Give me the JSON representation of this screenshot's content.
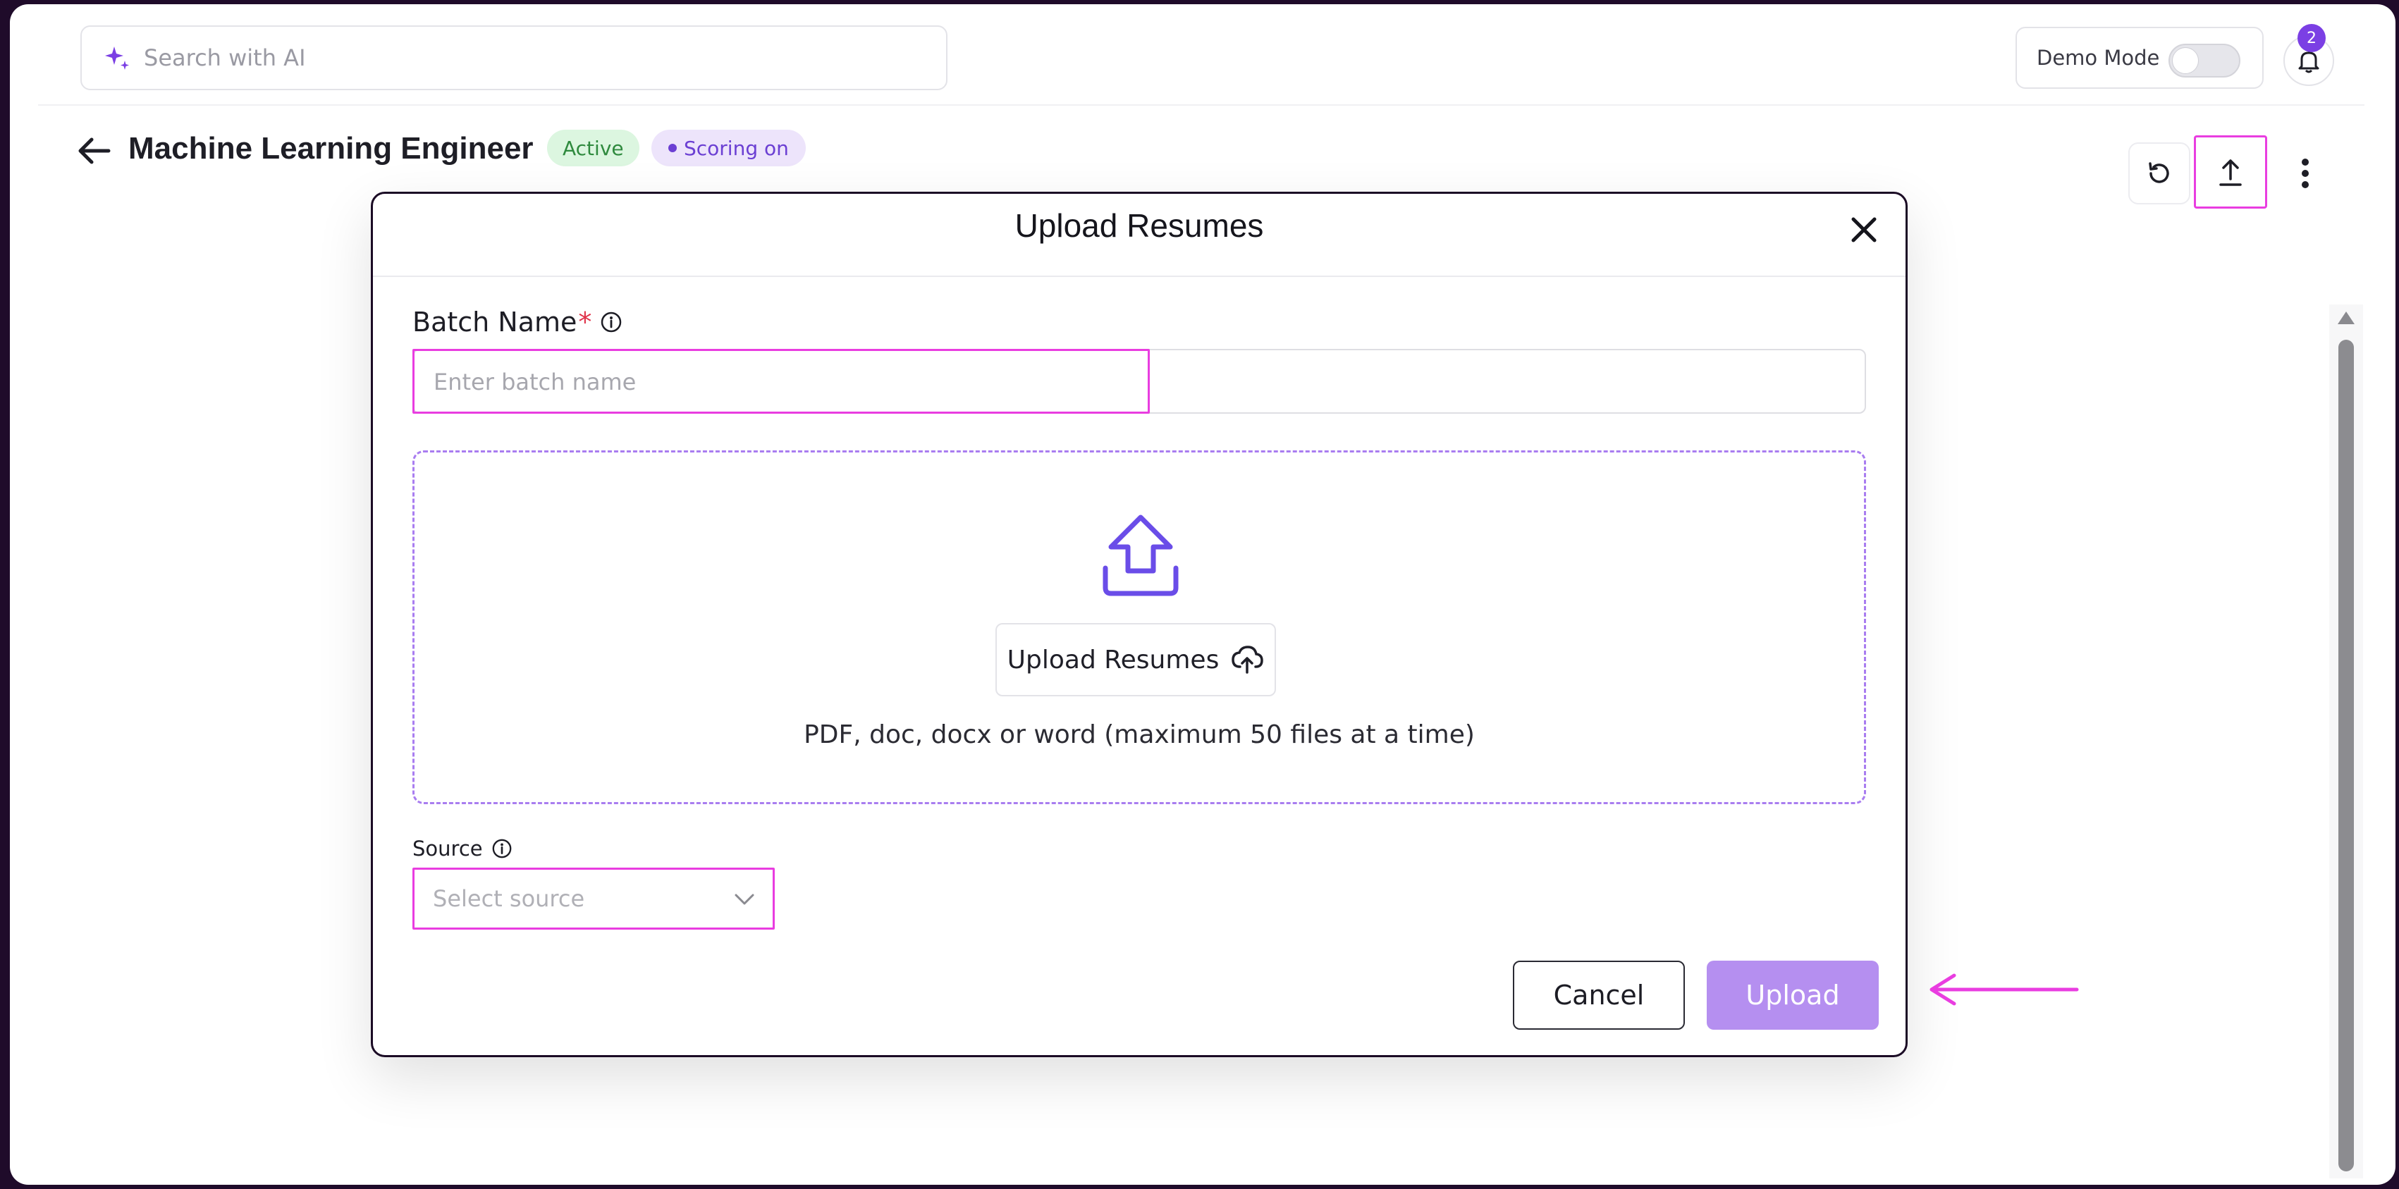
{
  "topbar": {
    "search_placeholder": "Search with AI",
    "demo_mode_label": "Demo Mode",
    "demo_mode_on": false,
    "notification_count": "2"
  },
  "header": {
    "title": "Machine Learning Engineer",
    "status_badge": "Active",
    "scoring_badge": "Scoring on"
  },
  "modal": {
    "title": "Upload Resumes",
    "batch_name_label": "Batch Name",
    "batch_name_required": "*",
    "batch_name_placeholder": "Enter batch name",
    "dropzone_button_label": "Upload Resumes",
    "dropzone_hint": "PDF, doc, docx or word (maximum 50 files at a time)",
    "source_label": "Source",
    "source_placeholder": "Select source",
    "cancel_label": "Cancel",
    "upload_label": "Upload"
  },
  "colors": {
    "accent": "#7b3fe4",
    "highlight": "#e93de0",
    "upload_button": "#b58ff0",
    "active_badge_bg": "#dcf6e0",
    "scoring_badge_bg": "#ede4fb"
  }
}
